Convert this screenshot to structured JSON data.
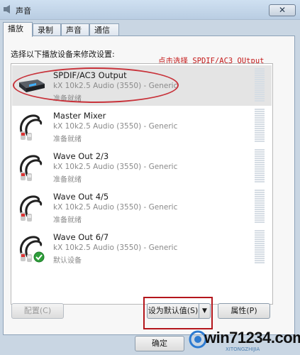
{
  "window": {
    "title": "声音",
    "close_label": "✕"
  },
  "tabs": [
    {
      "label": "播放"
    },
    {
      "label": "录制"
    },
    {
      "label": "声音"
    },
    {
      "label": "通信"
    }
  ],
  "instruction": "选择以下播放设备来修改设置:",
  "annotation": "点击选择 SPDIF/AC3 OUtput",
  "devices": [
    {
      "name": "SPDIF/AC3 Output",
      "description": "kX 10k2.5 Audio (3550) - Generic",
      "status": "准备就绪",
      "icon": "spdif-device-icon",
      "selected": true
    },
    {
      "name": "Master Mixer",
      "description": "kX 10k2.5 Audio (3550) - Generic",
      "status": "准备就绪",
      "icon": "rca-cable-icon"
    },
    {
      "name": "Wave Out 2/3",
      "description": "kX 10k2.5 Audio (3550) - Generic",
      "status": "准备就绪",
      "icon": "rca-cable-icon"
    },
    {
      "name": "Wave Out 4/5",
      "description": "kX 10k2.5 Audio (3550) - Generic",
      "status": "准备就绪",
      "icon": "rca-cable-icon"
    },
    {
      "name": "Wave Out 6/7",
      "description": "kX 10k2.5 Audio (3550) - Generic",
      "status": "默认设备",
      "icon": "rca-cable-icon",
      "default_badge": "check-icon"
    }
  ],
  "buttons": {
    "configure": "配置(C)",
    "set_default": "设为默认值(S)",
    "properties": "属性(P)",
    "ok": "确定"
  },
  "watermark": {
    "text": "win71234.com",
    "sub": "XITONGZHIJIA"
  },
  "colors": {
    "annotation": "#c41a1a",
    "highlight_box": "#b4161c",
    "selected_row": "#e4e4e4"
  }
}
